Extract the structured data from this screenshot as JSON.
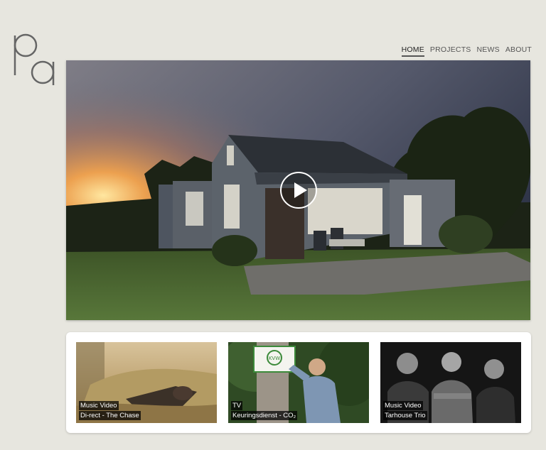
{
  "brand": {
    "logo_text": "pa"
  },
  "nav": {
    "items": [
      {
        "label": "HOME",
        "active": true
      },
      {
        "label": "PROJECTS",
        "active": false
      },
      {
        "label": "NEWS",
        "active": false
      },
      {
        "label": "ABOUT",
        "active": false
      }
    ]
  },
  "hero": {
    "play_icon": "play-icon"
  },
  "projects": [
    {
      "category": "Music Video",
      "title": "Di-rect - The Chase"
    },
    {
      "category": "TV",
      "title": "Keuringsdienst - CO₂"
    },
    {
      "category": "Music Video",
      "title": "Tarhouse Trio"
    }
  ],
  "sign_text": "KVW"
}
